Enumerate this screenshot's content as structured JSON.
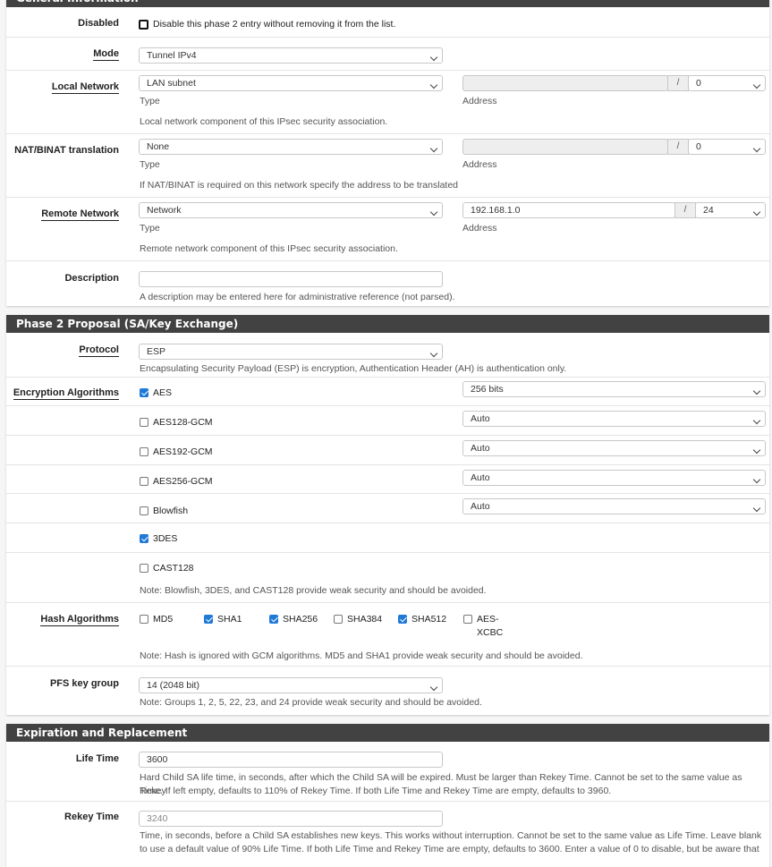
{
  "general": {
    "title": "General Information",
    "disabled": {
      "label": "Disabled",
      "checked": false,
      "text": "Disable this phase 2 entry without removing it from the list."
    },
    "mode": {
      "label": "Mode",
      "value": "Tunnel IPv4"
    },
    "local_network": {
      "label": "Local Network",
      "type": "LAN subnet",
      "type_label": "Type",
      "address": "",
      "mask": "0",
      "address_label": "Address",
      "help": "Local network component of this IPsec security association."
    },
    "nat": {
      "label": "NAT/BINAT translation",
      "type": "None",
      "type_label": "Type",
      "address": "",
      "mask": "0",
      "address_label": "Address",
      "help": "If NAT/BINAT is required on this network specify the address to be translated"
    },
    "remote_network": {
      "label": "Remote Network",
      "type": "Network",
      "type_label": "Type",
      "address": "192.168.1.0",
      "mask": "24",
      "address_label": "Address",
      "help": "Remote network component of this IPsec security association."
    },
    "description": {
      "label": "Description",
      "value": "",
      "help": "A description may be entered here for administrative reference (not parsed)."
    },
    "slash": "/"
  },
  "phase2": {
    "title": "Phase 2 Proposal (SA/Key Exchange)",
    "protocol": {
      "label": "Protocol",
      "value": "ESP",
      "help": "Encapsulating Security Payload (ESP) is encryption, Authentication Header (AH) is authentication only."
    },
    "encryption": {
      "label": "Encryption Algorithms",
      "items": [
        {
          "name": "AES",
          "checked": true,
          "keylen": "256 bits"
        },
        {
          "name": "AES128-GCM",
          "checked": false,
          "keylen": "Auto"
        },
        {
          "name": "AES192-GCM",
          "checked": false,
          "keylen": "Auto"
        },
        {
          "name": "AES256-GCM",
          "checked": false,
          "keylen": "Auto"
        },
        {
          "name": "Blowfish",
          "checked": false,
          "keylen": "Auto"
        },
        {
          "name": "3DES",
          "checked": true
        },
        {
          "name": "CAST128",
          "checked": false
        }
      ],
      "note": "Note: Blowfish, 3DES, and CAST128 provide weak security and should be avoided."
    },
    "hash": {
      "label": "Hash Algorithms",
      "items": [
        {
          "name": "MD5",
          "checked": false
        },
        {
          "name": "SHA1",
          "checked": true
        },
        {
          "name": "SHA256",
          "checked": true
        },
        {
          "name": "SHA384",
          "checked": false
        },
        {
          "name": "SHA512",
          "checked": true
        },
        {
          "name": "AES-",
          "name2": "XCBC",
          "checked": false
        }
      ],
      "note": "Note: Hash is ignored with GCM algorithms. MD5 and SHA1 provide weak security and should be avoided."
    },
    "pfs": {
      "label": "PFS key group",
      "value": "14 (2048 bit)",
      "note": "Note: Groups 1, 2, 5, 22, 23, and 24 provide weak security and should be avoided."
    }
  },
  "expiration": {
    "title": "Expiration and Replacement",
    "life": {
      "label": "Life Time",
      "value": "3600",
      "help1": "Hard Child SA life time, in seconds, after which the Child SA will be expired. Must be larger than Rekey Time. Cannot be set to the same value as Rekey",
      "help2": "Time. If left empty, defaults to 110% of Rekey Time. If both Life Time and Rekey Time are empty, defaults to 3960."
    },
    "rekey": {
      "label": "Rekey Time",
      "placeholder": "3240",
      "help1": "Time, in seconds, before a Child SA establishes new keys. This works without interruption. Cannot be set to the same value as Life Time. Leave blank",
      "help2": "to use a default value of 90% Life Time. If both Life Time and Rekey Time are empty, defaults to 3600. Enter a value of 0 to disable, but be aware that"
    }
  }
}
